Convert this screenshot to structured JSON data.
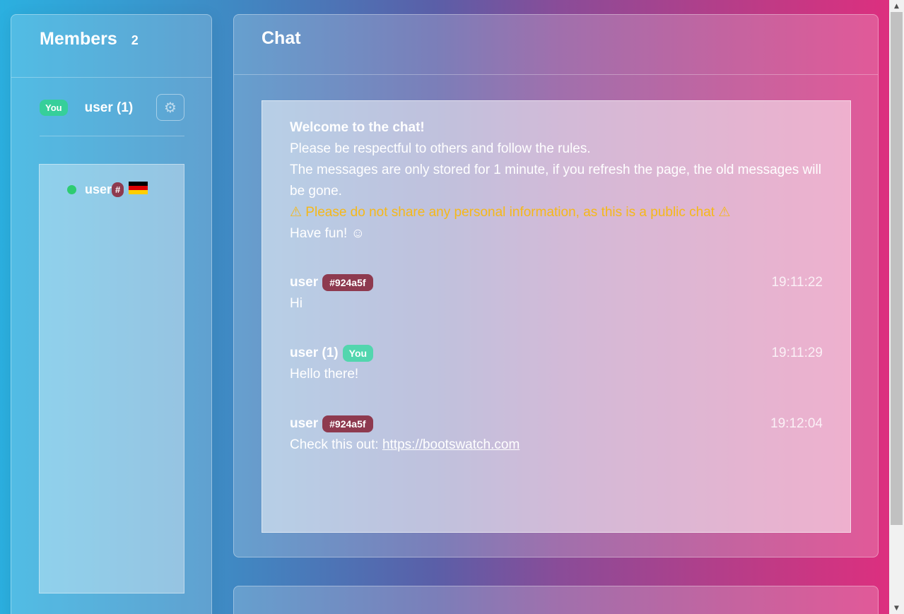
{
  "members": {
    "title": "Members",
    "count": "2",
    "self": {
      "badge": "You",
      "name": "user (1)",
      "settings_icon": "gear-icon"
    },
    "list": [
      {
        "name": "user",
        "badge": "#",
        "status": "online",
        "flag": "germany-flag",
        "status_color": "#2ecc71"
      }
    ]
  },
  "chat": {
    "title": "Chat",
    "welcome": {
      "title": "Welcome to the chat!",
      "line1": "Please be respectful to others and follow the rules.",
      "line2": "The messages are only stored for 1 minute, if you refresh the page, the old messages will be gone.",
      "warning": "⚠ Please do not share any personal information, as this is a public chat ⚠",
      "line3": "Have fun! ☺"
    },
    "messages": [
      {
        "user": "user",
        "badge": "#924a5f",
        "time": "19:11:22",
        "text": "Hi"
      },
      {
        "user": "user (1)",
        "badge": "You",
        "time": "19:11:29",
        "text": "Hello there!"
      },
      {
        "user": "user",
        "badge": "#924a5f",
        "time": "19:12:04",
        "text_prefix": "Check this out: ",
        "link": "https://bootswatch.com"
      }
    ]
  },
  "colors": {
    "you_badge": "#36cf9a",
    "hash_badge": "#8e3a4f",
    "warning": "#f5b81a",
    "online": "#2ecc71"
  }
}
